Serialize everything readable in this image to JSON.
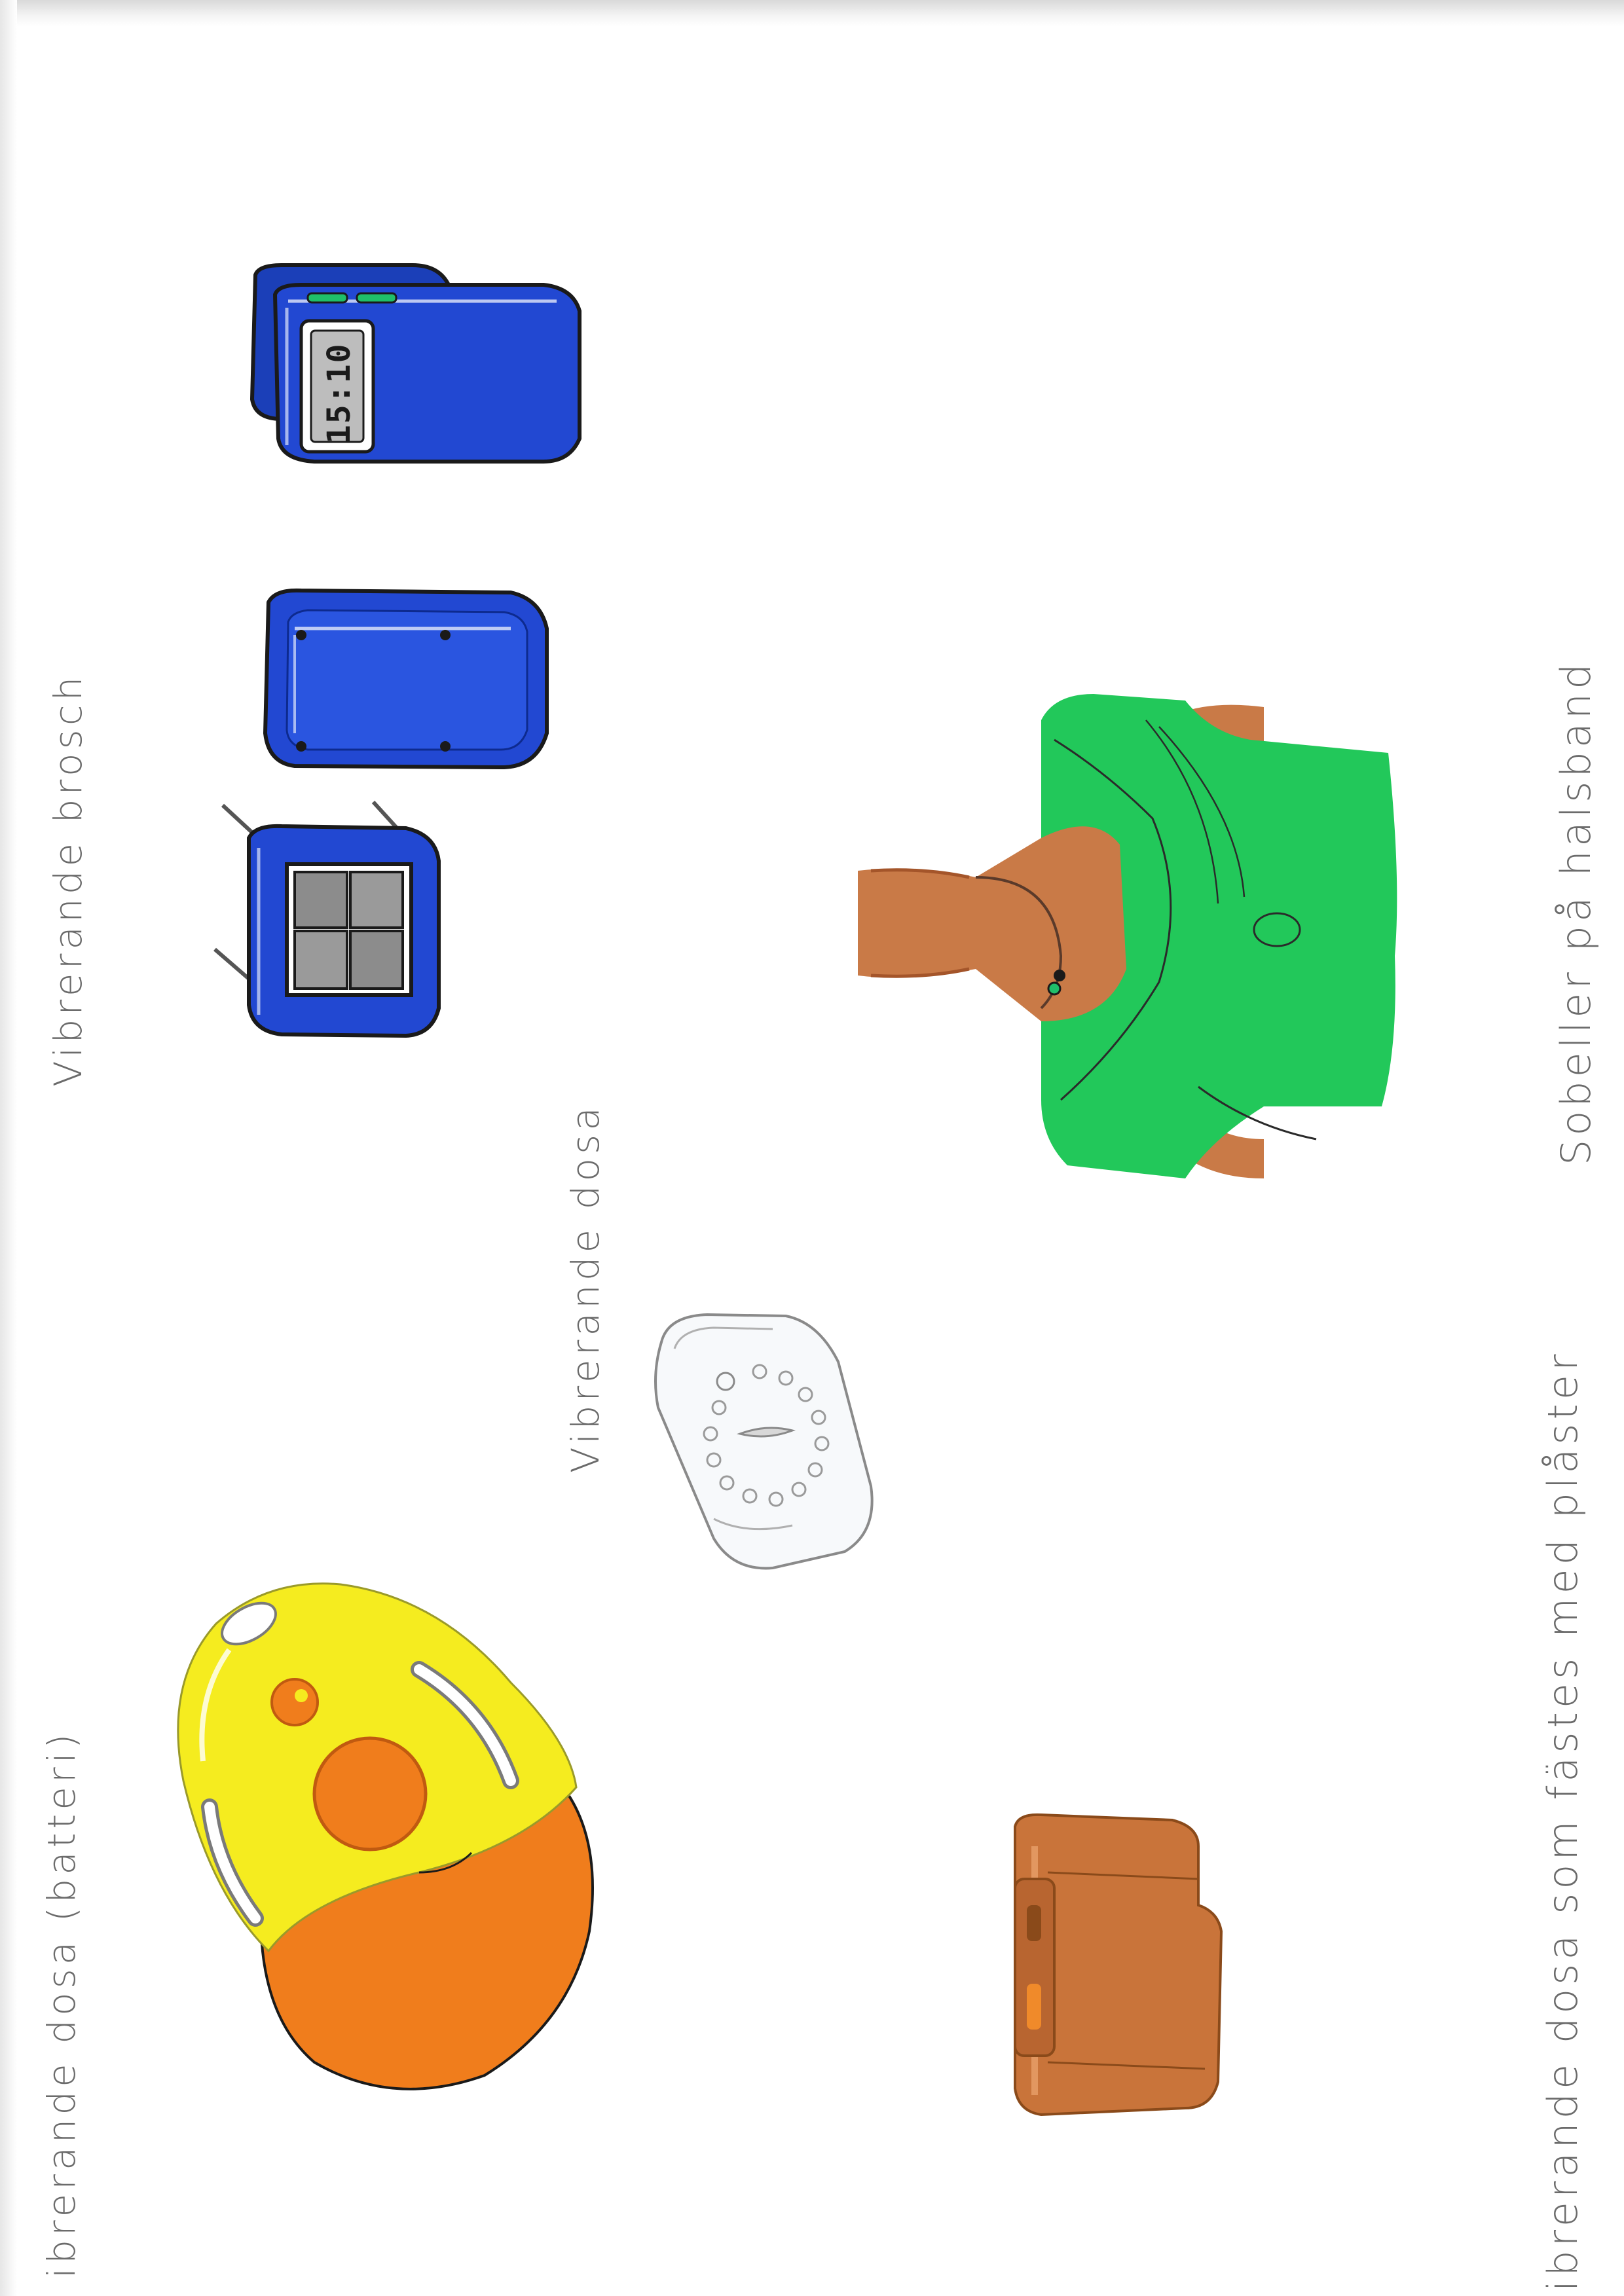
{
  "labels": {
    "brosch": "Vibrerande brosch",
    "dosa": "Vibrerande dosa",
    "batteri": "ibrerande dosa (batteri)",
    "halsband": "Sobeller på halsband",
    "plaster": "ibrerande dosa som fästes med plåster"
  },
  "clock_display": "15:10",
  "colors": {
    "brooch_blue": "#1f45c8",
    "brooch_blue_dark": "#0d2a8f",
    "display_green": "#1fbf6a",
    "shirt_green": "#22c85a",
    "skin": "#c97a47",
    "yellow": "#f5ec1f",
    "orange": "#f07d1c",
    "plaster_brown": "#c9743a",
    "outline": "#1a1a1a",
    "pencil": "#8a8a8a"
  }
}
